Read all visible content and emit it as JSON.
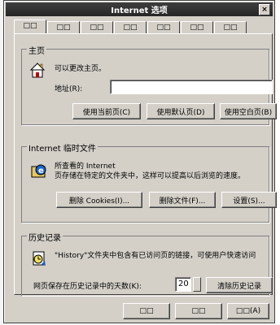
{
  "window": {
    "title": "Internet 选项",
    "close_glyph": "×"
  },
  "tabs": [
    {
      "label": "□□"
    },
    {
      "label": "□□"
    },
    {
      "label": "□□"
    },
    {
      "label": "□□"
    },
    {
      "label": "□□"
    },
    {
      "label": "□□"
    },
    {
      "label": "□□"
    }
  ],
  "home": {
    "group_title": "主页",
    "description": "可以更改主页。",
    "address_label": "地址(R):",
    "address_value": "",
    "buttons": [
      "使用当前页(C)",
      "使用默认页(D)",
      "使用空白页(B)"
    ]
  },
  "temp_files": {
    "group_title": "Internet 临时文件",
    "desc_line1": "所查看的 Internet",
    "desc_line2": "页存储在特定的文件夹中，这样可以提高以后浏览的速度。",
    "buttons": [
      "删除 Cookies(I)...",
      "删除文件(F)...",
      "设置(S)..."
    ]
  },
  "history": {
    "group_title": "历史记录",
    "description": "\"History\"文件夹中包含有已访问页的链接，可使用户快速访问",
    "days_label": "网页保存在历史记录中的天数(K):",
    "days_value": "20",
    "clear_button": "清除历史记录"
  },
  "footer": {
    "buttons": [
      "□□",
      "□□",
      "□□(A)"
    ]
  }
}
